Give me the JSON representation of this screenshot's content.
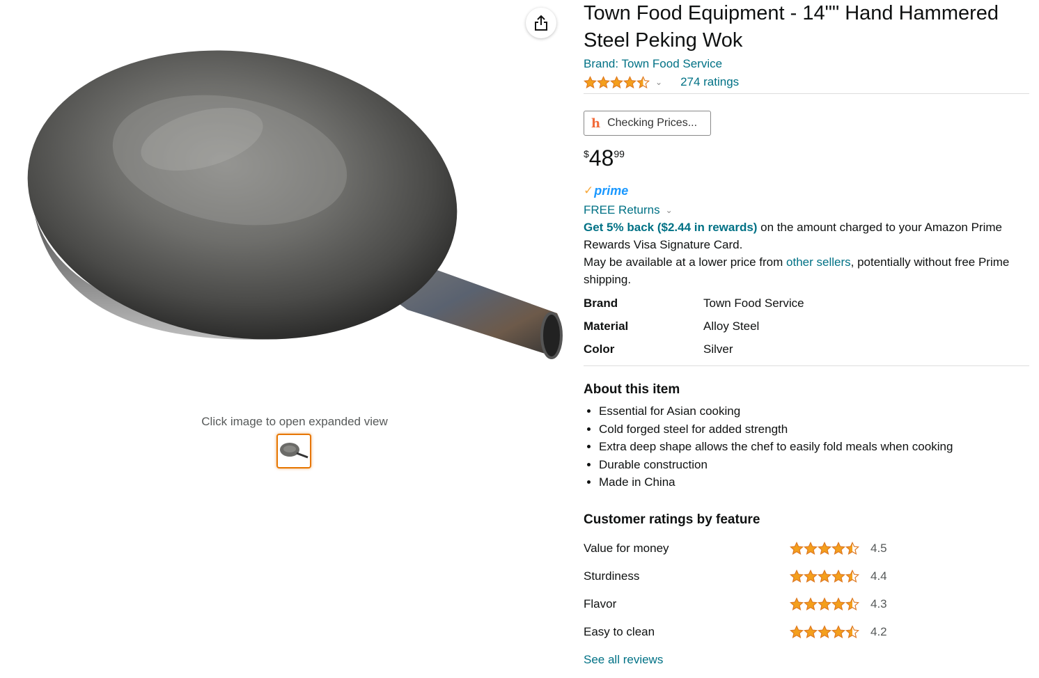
{
  "gallery": {
    "expand_hint": "Click image to open expanded view",
    "share_icon": "share-icon"
  },
  "product": {
    "title": "Town Food Equipment - 14\"\" Hand Hammered Steel Peking Wok",
    "brand_link": "Brand: Town Food Service",
    "rating_value": 4.5,
    "ratings_count": "274 ratings",
    "price_checker": "Checking Prices...",
    "price": {
      "symbol": "$",
      "whole": "48",
      "fraction": "99"
    },
    "prime_label": "prime",
    "free_returns": "FREE Returns",
    "rewards": {
      "link": "Get 5% back ($2.44 in rewards)",
      "text": " on the amount charged to your Amazon Prime Rewards Visa Signature Card."
    },
    "lower_price": {
      "before": "May be available at a lower price from ",
      "link": "other sellers",
      "after": ", potentially without free Prime shipping."
    },
    "specs": [
      {
        "key": "Brand",
        "value": "Town Food Service"
      },
      {
        "key": "Material",
        "value": "Alloy Steel"
      },
      {
        "key": "Color",
        "value": "Silver"
      }
    ]
  },
  "about": {
    "heading": "About this item",
    "bullets": [
      "Essential for Asian cooking",
      "Cold forged steel for added strength",
      "Extra deep shape allows the chef to easily fold meals when cooking",
      "Durable construction",
      "Made in China"
    ]
  },
  "feature_ratings": {
    "heading": "Customer ratings by feature",
    "items": [
      {
        "name": "Value for money",
        "value": "4.5",
        "stars": 4.5
      },
      {
        "name": "Sturdiness",
        "value": "4.4",
        "stars": 4.5
      },
      {
        "name": "Flavor",
        "value": "4.3",
        "stars": 4.5
      },
      {
        "name": "Easy to clean",
        "value": "4.2",
        "stars": 4.5
      }
    ],
    "see_all": "See all reviews"
  },
  "colors": {
    "link": "#007185",
    "star": "#F49F1C",
    "thumb_border": "#e77600",
    "prime": "#1a98ff"
  }
}
